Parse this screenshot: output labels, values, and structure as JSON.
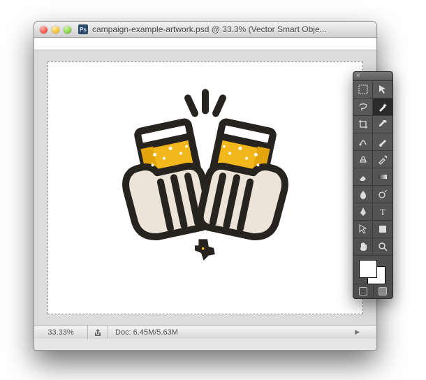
{
  "window": {
    "title": "campaign-example-artwork.psd @ 33.3% (Vector Smart Obje...",
    "app_abbrev": "Ps"
  },
  "status": {
    "zoom": "33.33%",
    "doc_size": "Doc: 6.45M/5.63M"
  },
  "artwork": {
    "description": "Two hands toasting with pint glasses of beer, clinking; splash lines above; small Texas silhouette with star below",
    "stroke": "#27231f",
    "beer": "#f2b81b",
    "beer_shade": "#e3a40c",
    "foam": "#ffffff",
    "hand": "#ece4d9"
  },
  "tools": {
    "items": [
      {
        "name": "marquee-tool-icon"
      },
      {
        "name": "move-tool-icon"
      },
      {
        "name": "lasso-tool-icon"
      },
      {
        "name": "magic-wand-tool-icon",
        "selected": true
      },
      {
        "name": "crop-tool-icon"
      },
      {
        "name": "eyedropper-tool-icon"
      },
      {
        "name": "healing-brush-tool-icon"
      },
      {
        "name": "brush-tool-icon"
      },
      {
        "name": "clone-stamp-tool-icon"
      },
      {
        "name": "history-brush-tool-icon"
      },
      {
        "name": "eraser-tool-icon"
      },
      {
        "name": "gradient-tool-icon"
      },
      {
        "name": "blur-tool-icon"
      },
      {
        "name": "dodge-tool-icon"
      },
      {
        "name": "pen-tool-icon"
      },
      {
        "name": "type-tool-icon"
      },
      {
        "name": "path-selection-tool-icon"
      },
      {
        "name": "shape-tool-icon"
      },
      {
        "name": "hand-tool-icon"
      },
      {
        "name": "zoom-tool-icon"
      }
    ],
    "swatch": {
      "fg": "#ffffff",
      "bg": "#ffffff"
    }
  }
}
